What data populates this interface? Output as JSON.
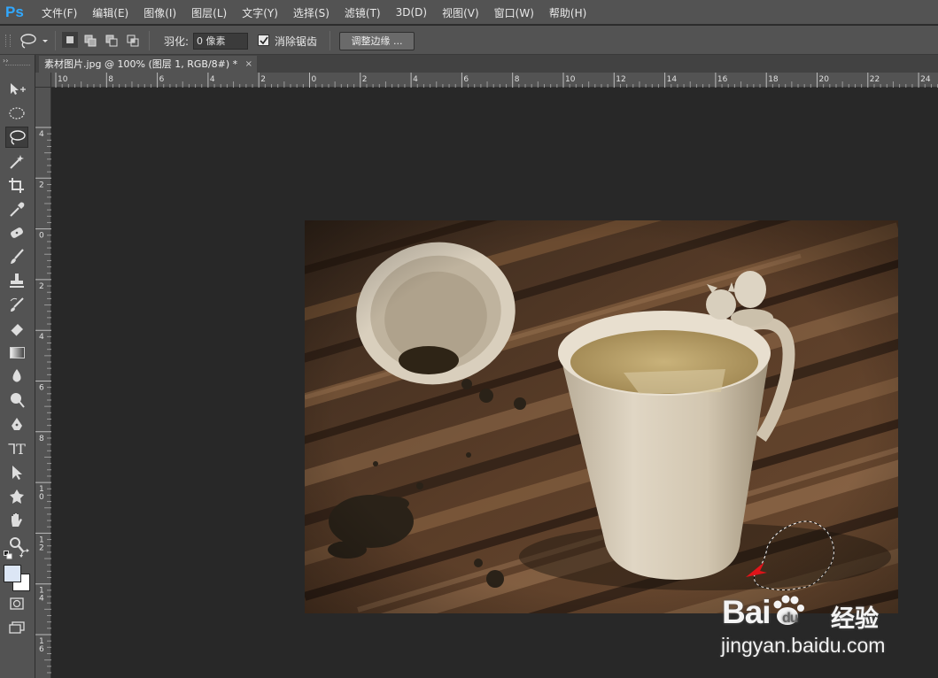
{
  "app": {
    "logo": "Ps"
  },
  "menu": [
    "文件(F)",
    "编辑(E)",
    "图像(I)",
    "图层(L)",
    "文字(Y)",
    "选择(S)",
    "滤镜(T)",
    "3D(D)",
    "视图(V)",
    "窗口(W)",
    "帮助(H)"
  ],
  "options": {
    "feather_label": "羽化:",
    "feather_value": "0 像素",
    "antialias_label": "消除锯齿",
    "antialias_checked": true,
    "refine_edge_label": "调整边缘 ..."
  },
  "document": {
    "tab_title": "素材图片.jpg @ 100% (图层 1, RGB/8#) *",
    "close_glyph": "×"
  },
  "ruler": {
    "h_labels": [
      "10",
      "8",
      "6",
      "4",
      "2",
      "0",
      "2",
      "4",
      "6",
      "8",
      "10",
      "12",
      "14",
      "16",
      "18",
      "20",
      "22",
      "24"
    ],
    "v_labels": [
      "4",
      "2",
      "0",
      "2",
      "4",
      "6",
      "8",
      "1\n0",
      "1\n2",
      "1\n4",
      "1\n6"
    ]
  },
  "tools": [
    "move-tool-icon",
    "marquee-tool-icon",
    "lasso-tool-icon",
    "magic-wand-icon",
    "crop-tool-icon",
    "eyedropper-icon",
    "healing-brush-icon",
    "brush-tool-icon",
    "clone-stamp-icon",
    "history-brush-icon",
    "eraser-icon",
    "gradient-icon",
    "blur-icon",
    "dodge-icon",
    "pen-tool-icon",
    "type-tool-icon",
    "path-selection-icon",
    "custom-shape-icon",
    "hand-tool-icon",
    "zoom-tool-icon"
  ],
  "colors": {
    "foreground": "#dce6f5",
    "background": "#ffffff",
    "accent": "#31a8ff"
  },
  "watermark": {
    "logo": "Bai",
    "brand": "经验",
    "url": "jingyan.baidu.com"
  }
}
